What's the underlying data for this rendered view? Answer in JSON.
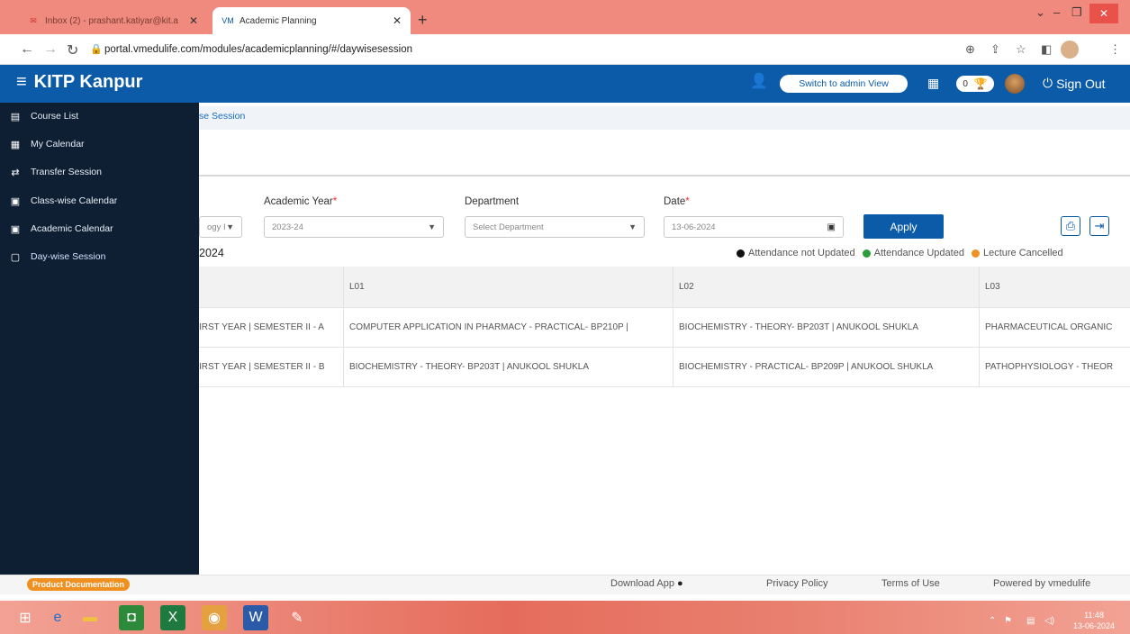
{
  "browser": {
    "tabs": [
      {
        "title": "Inbox (2) - prashant.katiyar@kit.a",
        "icon": "gmail-icon"
      },
      {
        "title": "Academic Planning",
        "icon": "vmedulife-icon"
      }
    ],
    "url": "portal.vmedulife.com/modules/academicplanning/#/daywisesession"
  },
  "header": {
    "brand": "KITP Kanpur",
    "switch_label": "Switch to admin View",
    "trophy_count": "0",
    "signout_label": "Sign Out"
  },
  "sidebar": {
    "items": [
      {
        "label": "Course List",
        "icon": "list-icon"
      },
      {
        "label": "My Calendar",
        "icon": "calendar-icon"
      },
      {
        "label": "Transfer Session",
        "icon": "transfer-icon"
      },
      {
        "label": "Class-wise Calendar",
        "icon": "calendar-icon"
      },
      {
        "label": "Academic Calendar",
        "icon": "calendar-icon"
      },
      {
        "label": "Day-wise Session",
        "icon": "calendar-day-icon"
      }
    ]
  },
  "breadcrumb": "se Session",
  "filters": {
    "program_value": "ogy I",
    "academic_year_label": "Academic Year",
    "academic_year_value": "2023-24",
    "department_label": "Department",
    "department_placeholder": "Select Department",
    "date_label": "Date",
    "date_value": "13-06-2024",
    "required_mark": "*",
    "apply_label": "Apply"
  },
  "date_heading": "2024",
  "legend": {
    "not_updated": "Attendance not Updated",
    "updated": "Attendance Updated",
    "cancelled": "Lecture Cancelled",
    "colors": {
      "not_updated": "#111111",
      "updated": "#2e9e3a",
      "cancelled": "#f09020"
    }
  },
  "table": {
    "headers": [
      "",
      "L01",
      "L02",
      "L03"
    ],
    "rows": [
      [
        "IRST YEAR | SEMESTER II - A",
        "COMPUTER APPLICATION IN PHARMACY - PRACTICAL- BP210P |",
        "BIOCHEMISTRY - THEORY- BP203T | ANUKOOL SHUKLA",
        "PHARMACEUTICAL ORGANIC"
      ],
      [
        "IRST YEAR | SEMESTER II - B",
        "BIOCHEMISTRY - THEORY- BP203T | ANUKOOL SHUKLA",
        "BIOCHEMISTRY - PRACTICAL- BP209P | ANUKOOL SHUKLA",
        "PATHOPHYSIOLOGY - THEOR"
      ]
    ]
  },
  "footer": {
    "product_doc": "Product Documentation",
    "download_app": "Download App",
    "privacy": "Privacy Policy",
    "terms": "Terms of Use",
    "powered": "Powered by vmedulife"
  },
  "taskbar": {
    "time": "11:48",
    "date": "13-06-2024"
  }
}
